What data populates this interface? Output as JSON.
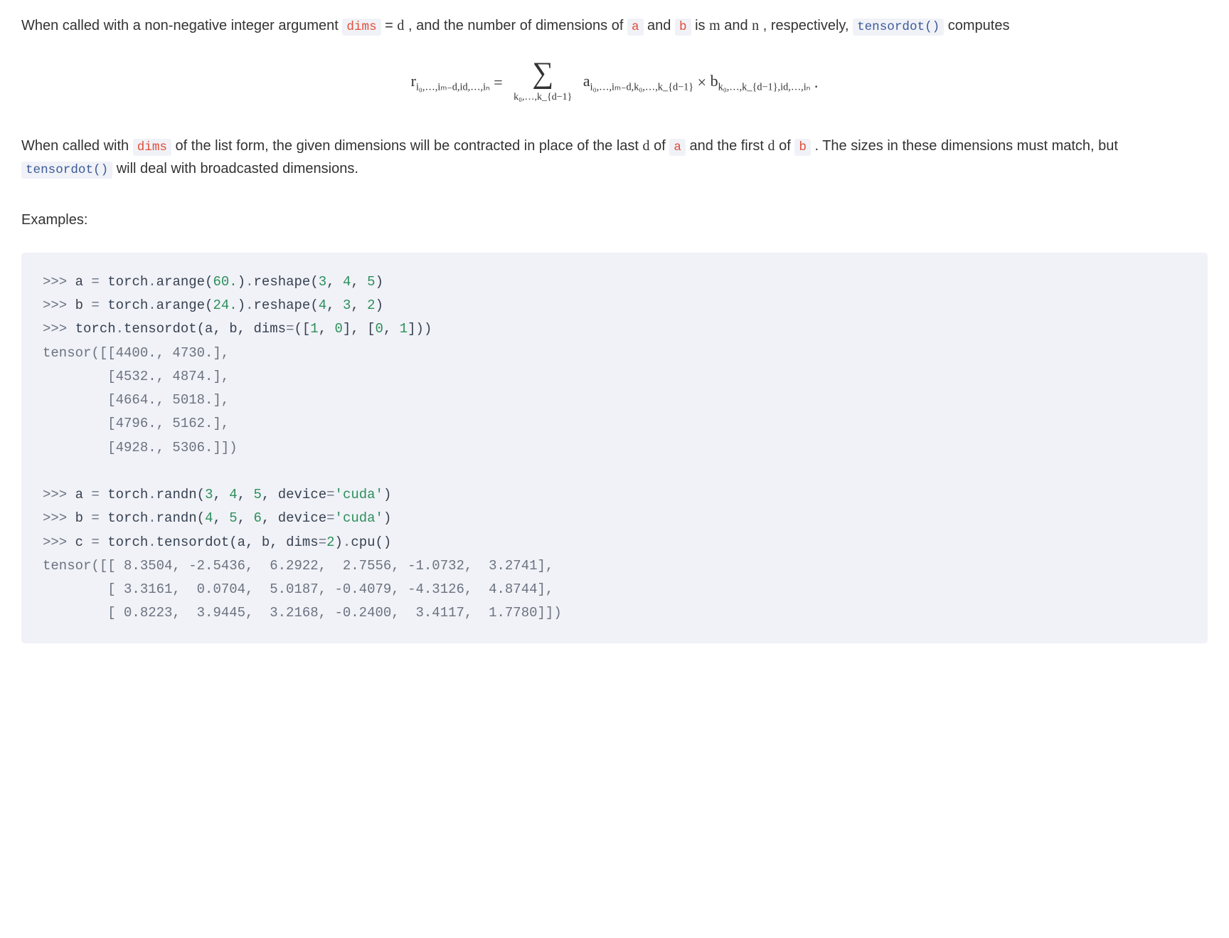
{
  "para1": {
    "t1": "When called with a non-negative integer argument ",
    "dims": "dims",
    "t2": " = ",
    "d": "d",
    "t3": " , and the number of dimensions of ",
    "a": "a",
    "t4": " and ",
    "b": "b",
    "t5": " is ",
    "m": "m",
    "t6": " and ",
    "n": "n",
    "t7": " , respectively, ",
    "fn": "tensordot()",
    "t8": " computes"
  },
  "formula": {
    "lhs_r": "r",
    "lhs_sub": "i₀,…,iₘ₋d,id,…,iₙ",
    "eq": " = ",
    "sum_sub": "k₀,…,k_{d−1}",
    "a": "a",
    "a_sub": "i₀,…,iₘ₋d,k₀,…,k_{d−1}",
    "times": " × ",
    "b": "b",
    "b_sub": "k₀,…,k_{d−1},id,…,iₙ",
    "dot": " ."
  },
  "para2": {
    "t1": "When called with ",
    "dims": "dims",
    "t2": " of the list form, the given dimensions will be contracted in place of the last ",
    "d1": "d",
    "t3": " of ",
    "a": "a",
    "t4": " and the first ",
    "d2": "d",
    "t5": " of ",
    "b": "b",
    "t6": " . The sizes in these dimensions must match, but ",
    "fn": "tensordot()",
    "t7": " will deal with broadcasted dimensions."
  },
  "examples_label": "Examples:",
  "code": {
    "l1_prompt": ">>> ",
    "l1_a": "a ",
    "l1_eq": "= ",
    "l1_rest1": "torch",
    "l1_dot1": ".",
    "l1_rest2": "arange(",
    "l1_n1": "60.",
    "l1_rest3": ")",
    "l1_dot2": ".",
    "l1_rest4": "reshape(",
    "l1_n2": "3",
    "l1_c1": ", ",
    "l1_n3": "4",
    "l1_c2": ", ",
    "l1_n4": "5",
    "l1_rest5": ")",
    "l2_prompt": ">>> ",
    "l2_a": "b ",
    "l2_eq": "= ",
    "l2_r1": "torch",
    "l2_d1": ".",
    "l2_r2": "arange(",
    "l2_n1": "24.",
    "l2_r3": ")",
    "l2_d2": ".",
    "l2_r4": "reshape(",
    "l2_n2": "4",
    "l2_c1": ", ",
    "l2_n3": "3",
    "l2_c2": ", ",
    "l2_n4": "2",
    "l2_r5": ")",
    "l3_prompt": ">>> ",
    "l3_r1": "torch",
    "l3_d1": ".",
    "l3_r2": "tensordot(a, b, dims",
    "l3_eq": "=",
    "l3_r3": "([",
    "l3_n1": "1",
    "l3_c1": ", ",
    "l3_n2": "0",
    "l3_r4": "], [",
    "l3_n3": "0",
    "l3_c2": ", ",
    "l3_n4": "1",
    "l3_r5": "]))",
    "out1_l1": "tensor([[4400., 4730.],",
    "out1_l2": "        [4532., 4874.],",
    "out1_l3": "        [4664., 5018.],",
    "out1_l4": "        [4796., 5162.],",
    "out1_l5": "        [4928., 5306.]])",
    "l4_prompt": ">>> ",
    "l4_a": "a ",
    "l4_eq": "= ",
    "l4_r1": "torch",
    "l4_d1": ".",
    "l4_r2": "randn(",
    "l4_n1": "3",
    "l4_c1": ", ",
    "l4_n2": "4",
    "l4_c2": ", ",
    "l4_n3": "5",
    "l4_c3": ", device",
    "l4_eq2": "=",
    "l4_s1": "'cuda'",
    "l4_r3": ")",
    "l5_prompt": ">>> ",
    "l5_a": "b ",
    "l5_eq": "= ",
    "l5_r1": "torch",
    "l5_d1": ".",
    "l5_r2": "randn(",
    "l5_n1": "4",
    "l5_c1": ", ",
    "l5_n2": "5",
    "l5_c2": ", ",
    "l5_n3": "6",
    "l5_c3": ", device",
    "l5_eq2": "=",
    "l5_s1": "'cuda'",
    "l5_r3": ")",
    "l6_prompt": ">>> ",
    "l6_a": "c ",
    "l6_eq": "= ",
    "l6_r1": "torch",
    "l6_d1": ".",
    "l6_r2": "tensordot(a, b, dims",
    "l6_eq2": "=",
    "l6_n1": "2",
    "l6_r3": ")",
    "l6_d2": ".",
    "l6_r4": "cpu()",
    "out2_l1": "tensor([[ 8.3504, -2.5436,  6.2922,  2.7556, -1.0732,  3.2741],",
    "out2_l2": "        [ 3.3161,  0.0704,  5.0187, -0.4079, -4.3126,  4.8744],",
    "out2_l3": "        [ 0.8223,  3.9445,  3.2168, -0.2400,  3.4117,  1.7780]])"
  }
}
